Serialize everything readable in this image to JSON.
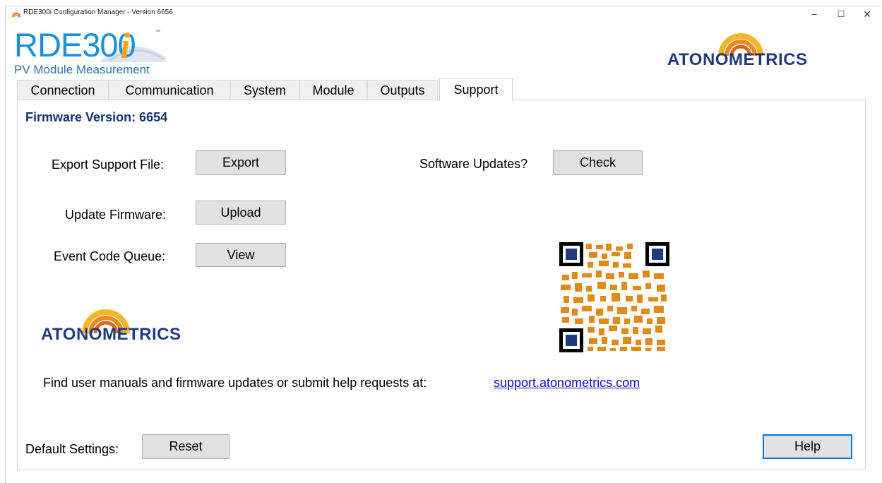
{
  "window": {
    "title": "RDE300i Configuration Manager - Version 6656"
  },
  "logo": {
    "brand": "RDE300",
    "brand_suffix": "i",
    "tm": "™",
    "subtitle": "PV Module Measurement",
    "company": "ATONOMETRICS",
    "company_color": "#1f3b80",
    "arc_color": "#f2a51a"
  },
  "tabs": [
    {
      "label": "Connection",
      "active": false
    },
    {
      "label": "Communication",
      "active": false
    },
    {
      "label": "System",
      "active": false
    },
    {
      "label": "Module",
      "active": false
    },
    {
      "label": "Outputs",
      "active": false
    },
    {
      "label": "Support",
      "active": true
    }
  ],
  "support": {
    "firmware_version": "Firmware Version: 6654",
    "export_label": "Export Support File:",
    "export_button": "Export",
    "updates_label": "Software Updates?",
    "check_button": "Check",
    "firmware_label": "Update Firmware:",
    "upload_button": "Upload",
    "event_label": "Event Code Queue:",
    "view_button": "View",
    "help_text": "Find user manuals and firmware updates or submit help requests at:",
    "link_text": "support.atonometrics.com",
    "default_label": "Default Settings:",
    "reset_button": "Reset",
    "help_button": "Help"
  },
  "colors": {
    "accent": "#0078d7",
    "heading": "#14316f",
    "link": "#0a0ad8",
    "qr_orange": "#e08a1a"
  }
}
